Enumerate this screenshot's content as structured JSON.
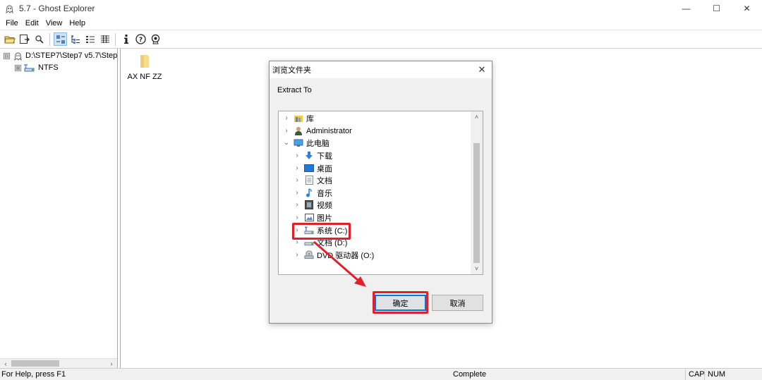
{
  "window": {
    "title": "5.7 - Ghost Explorer",
    "minimize_glyph": "—",
    "maximize_glyph": "☐",
    "close_glyph": "✕"
  },
  "menu": [
    "File",
    "Edit",
    "View",
    "Help"
  ],
  "toolbar": {
    "icons": [
      "open-folder-icon",
      "save-icon",
      "find-icon",
      "large-icons-view-icon",
      "list-view-icon",
      "tree-view-icon",
      "details-view-icon",
      "info-icon",
      "help-icon",
      "support-icon"
    ]
  },
  "tree": {
    "root_label": "D:\\STEP7\\Step7 v5.7\\Step",
    "child_label": "NTFS",
    "expand_glyph": "⊟",
    "child_expand_glyph": "⊞"
  },
  "scroll_left_glyph": "‹",
  "scroll_right_glyph": "›",
  "content": {
    "folder_label": "AX NF ZZ"
  },
  "status": {
    "help_text": "For Help, press F1",
    "state_text": "Complete",
    "cap": "CAP",
    "num": "NUM"
  },
  "dialog": {
    "title": "浏览文件夹",
    "prompt": "Extract To",
    "close_glyph": "✕",
    "items": [
      {
        "label": "库",
        "chevron": "›",
        "icon": "library-icon"
      },
      {
        "label": "Administrator",
        "chevron": "›",
        "icon": "user-icon"
      },
      {
        "label": "此电脑",
        "chevron": "⌄",
        "icon": "computer-icon"
      },
      {
        "label": "下载",
        "chevron": "›",
        "icon": "download-icon"
      },
      {
        "label": "桌面",
        "chevron": "›",
        "icon": "desktop-icon"
      },
      {
        "label": "文档",
        "chevron": "›",
        "icon": "documents-icon"
      },
      {
        "label": "音乐",
        "chevron": "›",
        "icon": "music-icon"
      },
      {
        "label": "视频",
        "chevron": "›",
        "icon": "video-icon"
      },
      {
        "label": "图片",
        "chevron": "›",
        "icon": "pictures-icon"
      },
      {
        "label": "系统 (C:)",
        "chevron": "›",
        "icon": "drive-c-icon"
      },
      {
        "label": "文档 (D:)",
        "chevron": "›",
        "icon": "drive-d-icon"
      },
      {
        "label": "DVD 驱动器 (O:)",
        "chevron": "›",
        "icon": "dvd-drive-icon"
      }
    ],
    "scroll_up_glyph": "˄",
    "scroll_down_glyph": "˅",
    "ok_label": "确定",
    "cancel_label": "取消"
  },
  "colors": {
    "highlight": "#e0202a",
    "accent": "#0078d7"
  }
}
